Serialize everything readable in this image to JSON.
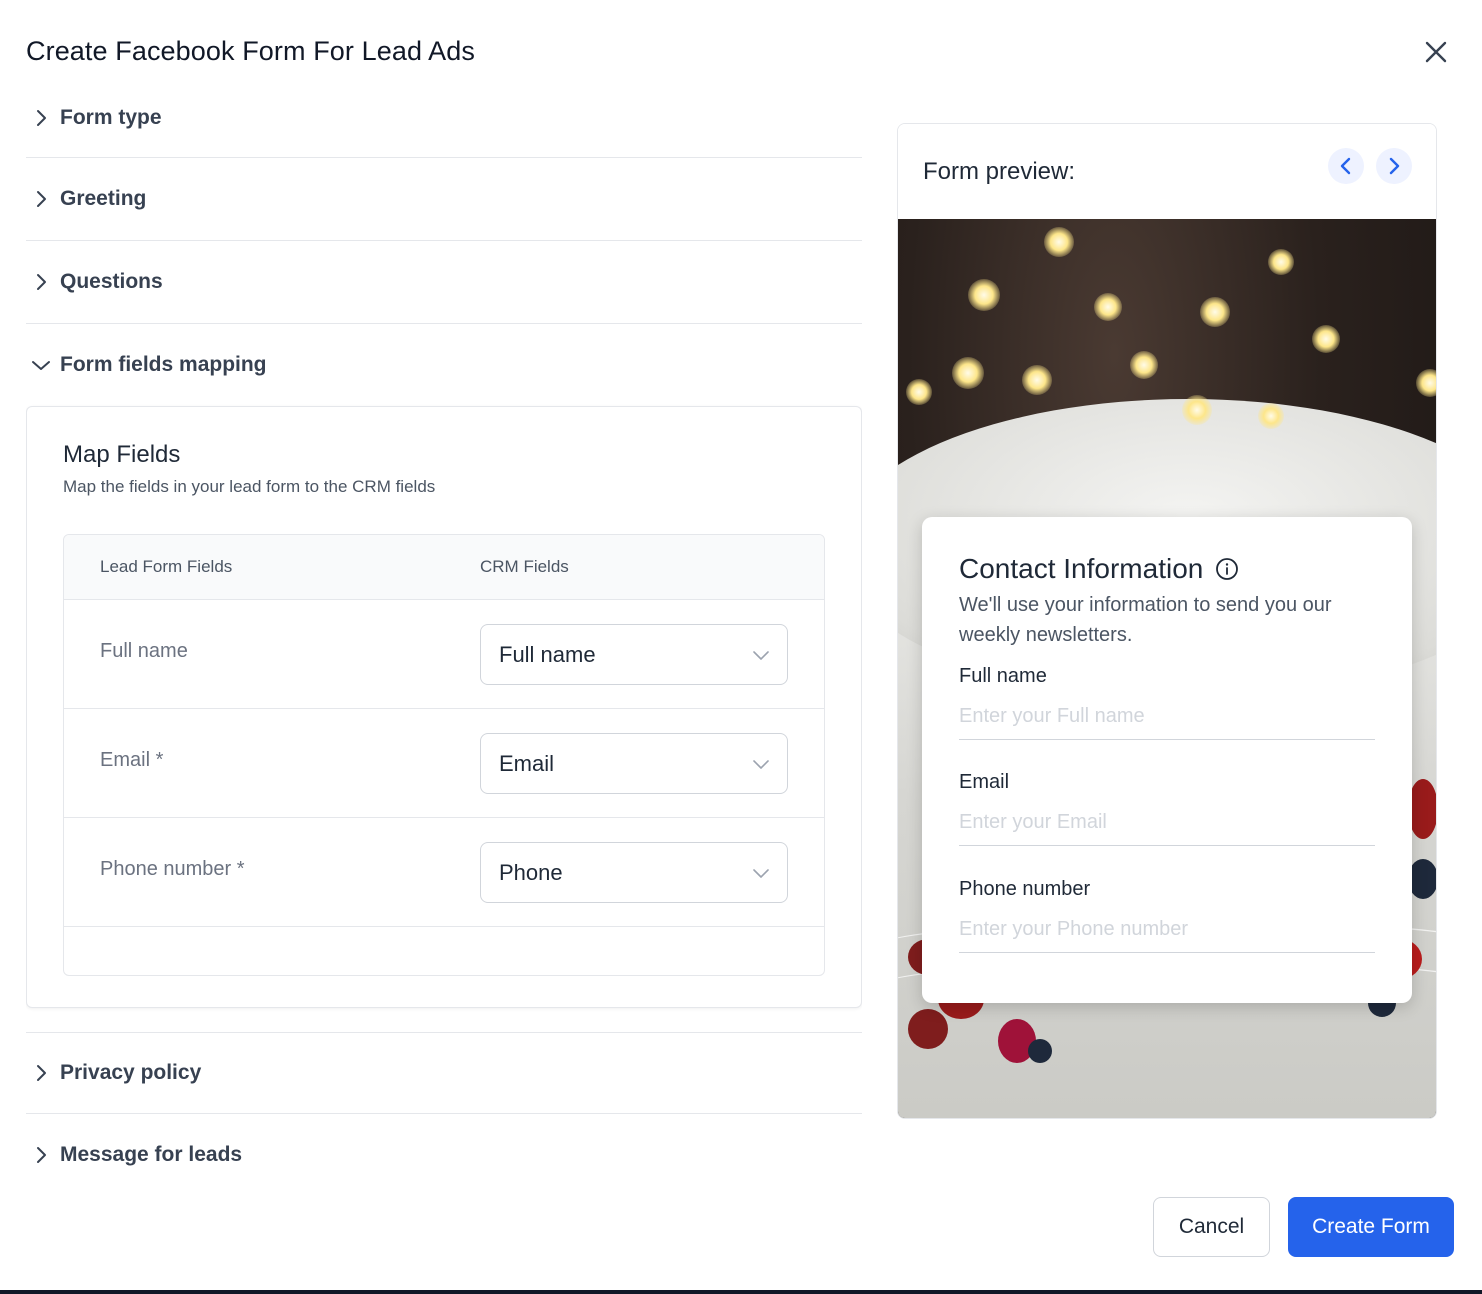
{
  "modal": {
    "title": "Create Facebook Form For Lead Ads"
  },
  "sections": {
    "form_type": "Form type",
    "greeting": "Greeting",
    "questions": "Questions",
    "form_fields_mapping": "Form fields mapping",
    "privacy_policy": "Privacy policy",
    "message_for_leads": "Message for leads"
  },
  "map_fields": {
    "title": "Map Fields",
    "subtitle": "Map the fields in your lead form to the CRM fields",
    "columns": [
      "Lead Form Fields",
      "CRM Fields"
    ],
    "rows": [
      {
        "lead_field": "Full name",
        "crm_field": "Full name"
      },
      {
        "lead_field": "Email *",
        "crm_field": "Email"
      },
      {
        "lead_field": "Phone number *",
        "crm_field": "Phone"
      }
    ]
  },
  "preview": {
    "title": "Form preview:",
    "contact": {
      "title": "Contact Information",
      "description": "We'll use your information to send you our weekly newsletters.",
      "fields": [
        {
          "label": "Full name",
          "placeholder": "Enter your Full name"
        },
        {
          "label": "Email",
          "placeholder": "Enter your Email"
        },
        {
          "label": "Phone number",
          "placeholder": "Enter your Phone number"
        }
      ]
    }
  },
  "footer": {
    "cancel_label": "Cancel",
    "create_label": "Create Form"
  },
  "colors": {
    "primary": "#2563eb",
    "border": "#e5e7eb",
    "text": "#1f2937"
  },
  "icons": {
    "close": "close-icon",
    "chevron_right": "chevron-right-icon",
    "chevron_down": "chevron-down-icon",
    "prev": "chevron-left-icon",
    "next": "chevron-right-icon",
    "info": "info-icon"
  }
}
